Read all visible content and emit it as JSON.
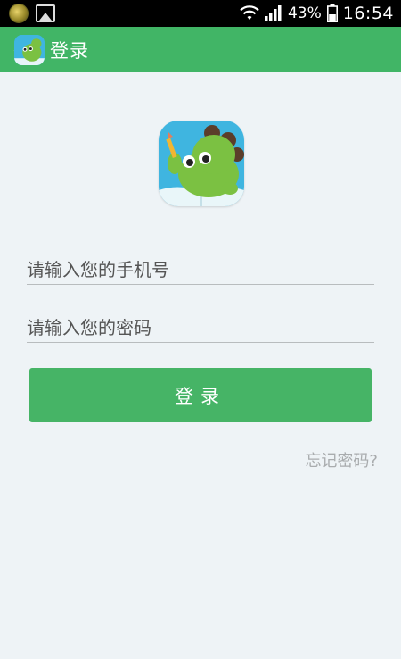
{
  "status_bar": {
    "battery_percent": "43%",
    "time": "16:54",
    "icons": [
      "notification-app-icon",
      "gallery-icon",
      "wifi-icon",
      "signal-icon",
      "battery-icon"
    ]
  },
  "app_bar": {
    "back_glyph": "〈",
    "title": "登录"
  },
  "login": {
    "phone_placeholder": "请输入您的手机号",
    "password_placeholder": "请输入您的密码",
    "button_label": "登录",
    "forgot_password": "忘记密码?"
  },
  "colors": {
    "brand_green": "#41b566",
    "button_green": "#46b466",
    "logo_blue": "#3fb5e0",
    "background": "#eef3f6"
  }
}
